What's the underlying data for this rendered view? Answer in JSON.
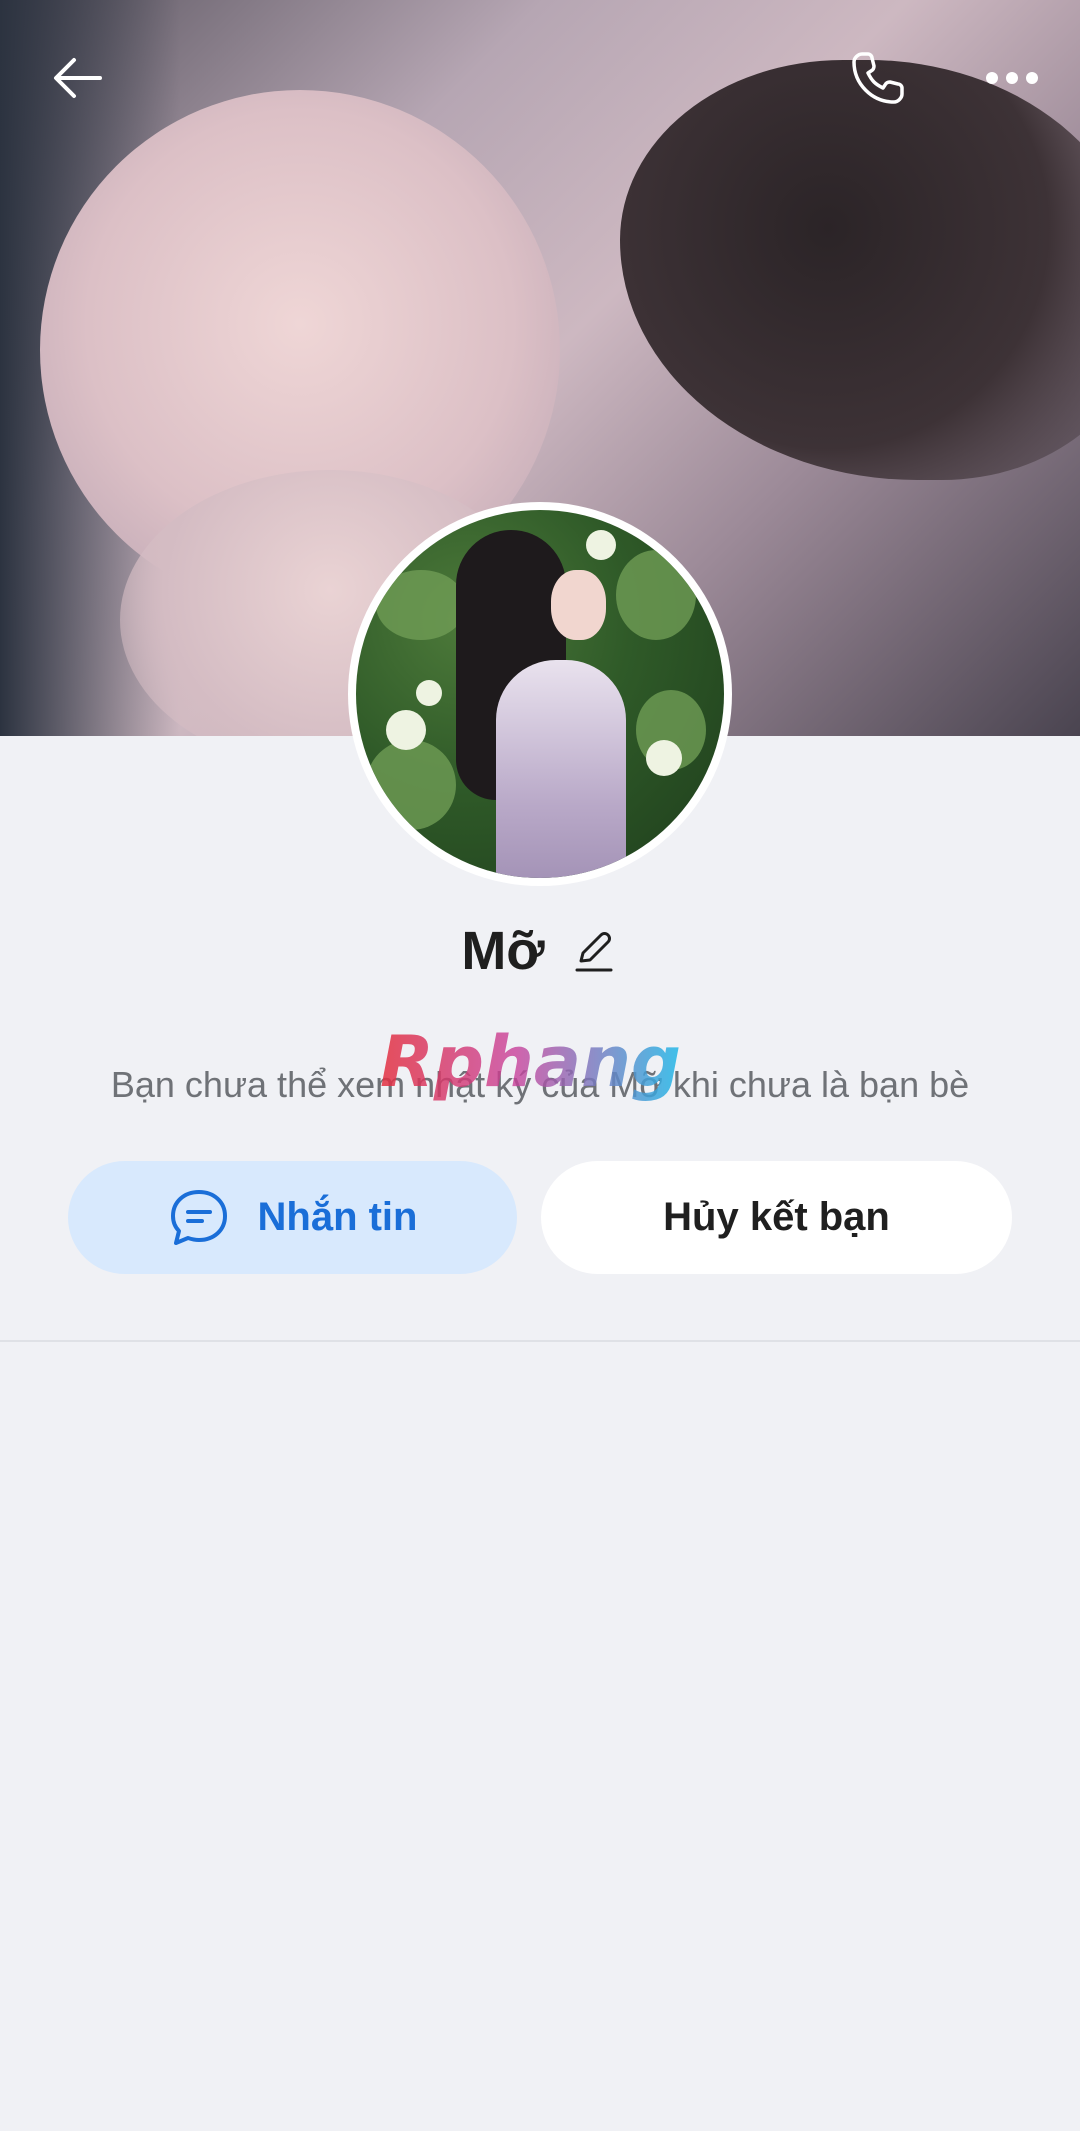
{
  "header": {
    "back_icon": "arrow-left-icon",
    "call_icon": "phone-icon",
    "more_icon": "more-horizontal-icon"
  },
  "profile": {
    "name": "Mỡ",
    "edit_icon": "pencil-icon",
    "notice": "Bạn chưa thể xem nhật ký của Mỡ khi chưa là bạn bè"
  },
  "watermark": {
    "text": "Rphang"
  },
  "actions": {
    "message_label": "Nhắn tin",
    "message_icon": "chat-bubble-icon",
    "unfriend_label": "Hủy kết bạn"
  },
  "colors": {
    "accent": "#1a6ed8",
    "accent_bg": "#d8e9fd",
    "page_bg": "#f0f1f5"
  }
}
